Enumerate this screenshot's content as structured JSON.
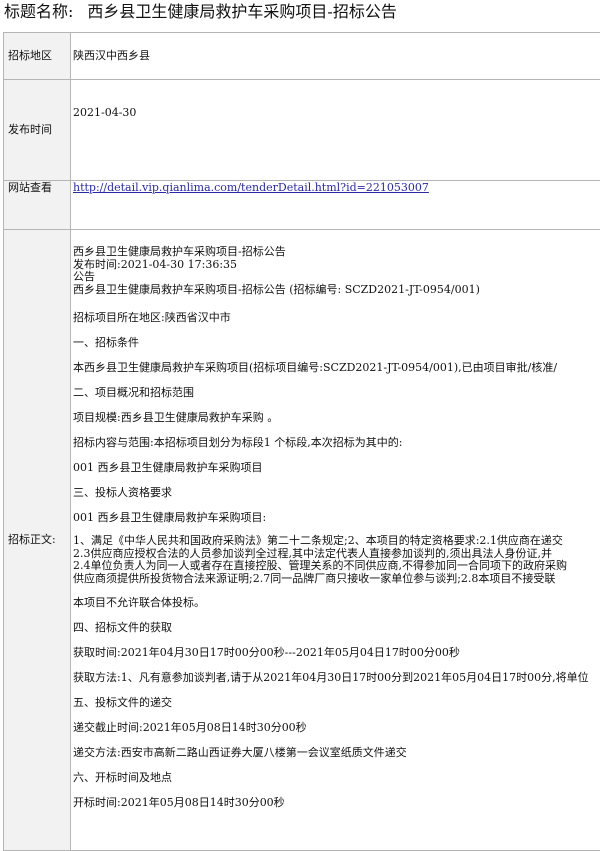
{
  "title": {
    "label": "标题名称:",
    "text": "西乡县卫生健康局救护车采购项目-招标公告"
  },
  "rows": {
    "region": {
      "key": "招标地区",
      "value": "陕西汉中西乡县"
    },
    "publish_time": {
      "key": "发布时间",
      "value": "2021-04-30"
    },
    "website": {
      "key": "网站查看",
      "value": "http://detail.vip.qianlima.com/tenderDetail.html?id=221053007"
    },
    "body": {
      "key": "招标正文:"
    }
  },
  "content": {
    "header_lines": [
      "西乡县卫生健康局救护车采购项目-招标公告",
      "发布时间:2021-04-30 17:36:35",
      "公告",
      "西乡县卫生健康局救护车采购项目-招标公告 (招标编号: SCZD2021-JT-0954/001)"
    ],
    "location": "招标项目所在地区:陕西省汉中市",
    "sec1_title": "一、招标条件",
    "sec1_text": "本西乡县卫生健康局救护车采购项目(招标项目编号:SCZD2021-JT-0954/001),已由项目审批/核准/",
    "sec2_title": "二、项目概况和招标范围",
    "scale": "项目规模:西乡县卫生健康局救护车采购 。",
    "scope": "招标内容与范围:本招标项目划分为标段1 个标段,本次招标为其中的:",
    "lot": "001 西乡县卫生健康局救护车采购项目",
    "sec3_title": "三、投标人资格要求",
    "lot_qual": "001 西乡县卫生健康局救护车采购项目:",
    "qual_lines": [
      "1、满足《中华人民共和国政府采购法》第二十二条规定;2、本项目的特定资格要求:2.1供应商在递交",
      "2.3供应商应授权合法的人员参加谈判全过程,其中法定代表人直接参加谈判的,须出具法人身份证,并",
      "2.4单位负责人为同一人或者存在直接控股、管理关系的不同供应商,不得参加同一合同项下的政府采购",
      "供应商须提供所投货物合法来源证明;2.7同一品牌厂商只接收一家单位参与谈判;2.8本项目不接受联"
    ],
    "no_consortium": "本项目不允许联合体投标。",
    "sec4_title": "四、招标文件的获取",
    "obtain_time": "获取时间:2021年04月30日17时00分00秒---2021年05月04日17时00分00秒",
    "obtain_method": "获取方法:1、凡有意参加谈判者,请于从2021年04月30日17时00分到2021年05月04日17时00分,将单位",
    "sec5_title": "五、投标文件的递交",
    "deadline": "递交截止时间:2021年05月08日14时30分00秒",
    "submit_method": "递交方法:西安市高新二路山西证券大厦八楼第一会议室纸质文件递交",
    "sec6_title": "六、开标时间及地点",
    "open_time": "开标时间:2021年05月08日14时30分00秒"
  }
}
